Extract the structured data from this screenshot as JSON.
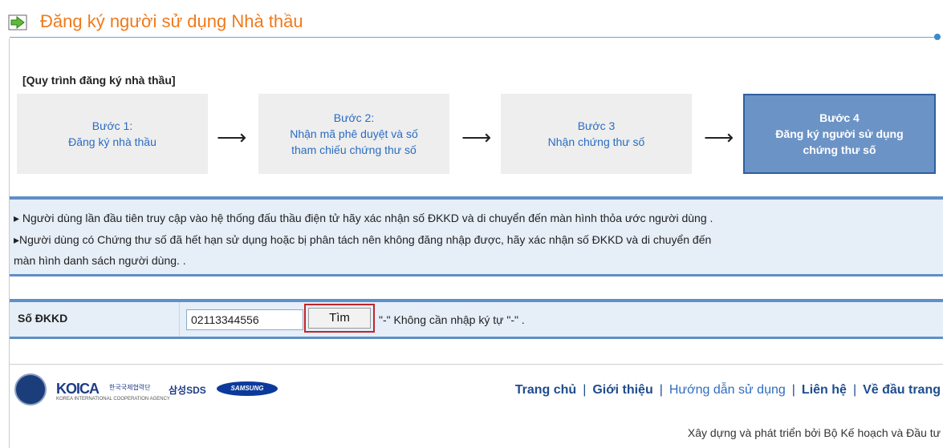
{
  "page": {
    "title": "Đăng ký người sử dụng Nhà thầu",
    "colors": {
      "title": "#f07a1a",
      "accent_blue": "#5e8fc7",
      "active_step_bg": "#6b93c6",
      "step_text": "#2a6cc2"
    }
  },
  "process": {
    "heading": "[Quy trình đăng ký nhà thầu]",
    "steps": [
      {
        "line1": "Bước 1:",
        "line2": "Đăng ký nhà thầu",
        "line3": ""
      },
      {
        "line1": "Bước 2:",
        "line2": "Nhận mã phê duyệt và số",
        "line3": "tham chiếu chứng thư số"
      },
      {
        "line1": "Bước 3",
        "line2": "Nhận chứng thư số",
        "line3": ""
      },
      {
        "line1": "Bước 4",
        "line2": "Đăng ký người sử dụng",
        "line3": "chứng thư số",
        "active": true
      }
    ],
    "arrow": "⟶"
  },
  "info": {
    "line1": "▸ Người dùng lần đầu tiên truy cập vào hệ thống đấu thầu điện tử hãy xác nhận số ĐKKD và di chuyển đến màn hình thỏa ước người dùng .",
    "line2": "▸Người dùng có Chứng thư số đã hết hạn sử dụng hoặc bị phân tách nên không đăng nhập được, hãy xác nhận số ĐKKD và di chuyển đến",
    "line3": "màn hình danh sách người dùng. ."
  },
  "search": {
    "label": "Số ĐKKD",
    "value": "02113344556",
    "button": "Tìm",
    "hint": "\"-\" Không cần nhập ký tự \"-\" ."
  },
  "footer": {
    "logos": {
      "koica": "KOICA",
      "koica_kr": "한국국제협력단",
      "koica_sub": "KOREA INTERNATIONAL COOPERATION AGENCY",
      "sds": "삼성SDS",
      "samsung": "SAMSUNG"
    },
    "nav": [
      "Trang chủ",
      "Giới thiệu",
      "Hướng dẫn sử dụng",
      "Liên hệ",
      "Về đầu trang"
    ],
    "credit": "Xây dựng và phát triển bởi Bộ Kế hoạch và Đầu tư"
  }
}
